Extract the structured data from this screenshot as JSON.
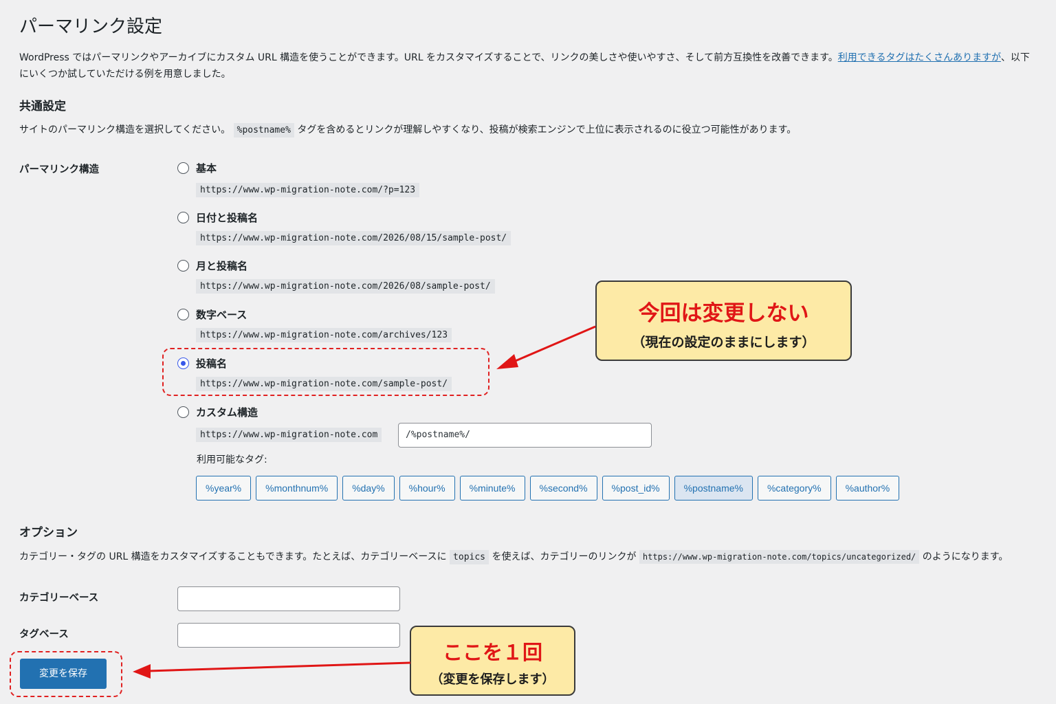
{
  "page": {
    "title": "パーマリンク設定"
  },
  "intro": {
    "text_before": "WordPress ではパーマリンクやアーカイブにカスタム URL 構造を使うことができます。URL をカスタマイズすることで、リンクの美しさや使いやすさ、そして前方互換性を改善できます。",
    "link_text": "利用できるタグはたくさんありますが",
    "text_after": "、以下にいくつか試していただける例を用意しました。"
  },
  "common": {
    "heading": "共通設定",
    "desc_before": "サイトのパーマリンク構造を選択してください。",
    "desc_code": "%postname%",
    "desc_after": "タグを含めるとリンクが理解しやすくなり、投稿が検索エンジンで上位に表示されるのに役立つ可能性があります。",
    "row_label": "パーマリンク構造",
    "options": [
      {
        "label": "基本",
        "url": "https://www.wp-migration-note.com/?p=123",
        "checked": false
      },
      {
        "label": "日付と投稿名",
        "url": "https://www.wp-migration-note.com/2026/08/15/sample-post/",
        "checked": false
      },
      {
        "label": "月と投稿名",
        "url": "https://www.wp-migration-note.com/2026/08/sample-post/",
        "checked": false
      },
      {
        "label": "数字ベース",
        "url": "https://www.wp-migration-note.com/archives/123",
        "checked": false
      },
      {
        "label": "投稿名",
        "url": "https://www.wp-migration-note.com/sample-post/",
        "checked": true
      },
      {
        "label": "カスタム構造",
        "url": "https://www.wp-migration-note.com",
        "checked": false
      }
    ],
    "custom_value": "/%postname%/",
    "available_tags_label": "利用可能なタグ:",
    "tags": [
      "%year%",
      "%monthnum%",
      "%day%",
      "%hour%",
      "%minute%",
      "%second%",
      "%post_id%",
      "%postname%",
      "%category%",
      "%author%"
    ],
    "active_tag": "%postname%"
  },
  "options_section": {
    "heading": "オプション",
    "desc_before": "カテゴリー・タグの URL 構造をカスタマイズすることもできます。たとえば、カテゴリーベースに",
    "desc_code1": "topics",
    "desc_mid": "を使えば、カテゴリーのリンクが",
    "desc_code2": "https://www.wp-migration-note.com/topics/uncategorized/",
    "desc_after": "のようになります。",
    "category_base_label": "カテゴリーベース",
    "category_base_value": "",
    "tag_base_label": "タグベース",
    "tag_base_value": ""
  },
  "save_button": "変更を保存",
  "annotations": {
    "callout1_big": "今回は変更しない",
    "callout1_small": "（現在の設定のままにします）",
    "callout2_big": "ここを１回",
    "callout2_small": "（変更を保存します）"
  },
  "colors": {
    "accent": "#2271b1",
    "annotation_red": "#e01616",
    "callout_bg": "#fdeaa6",
    "radio_checked": "#3858e9"
  }
}
